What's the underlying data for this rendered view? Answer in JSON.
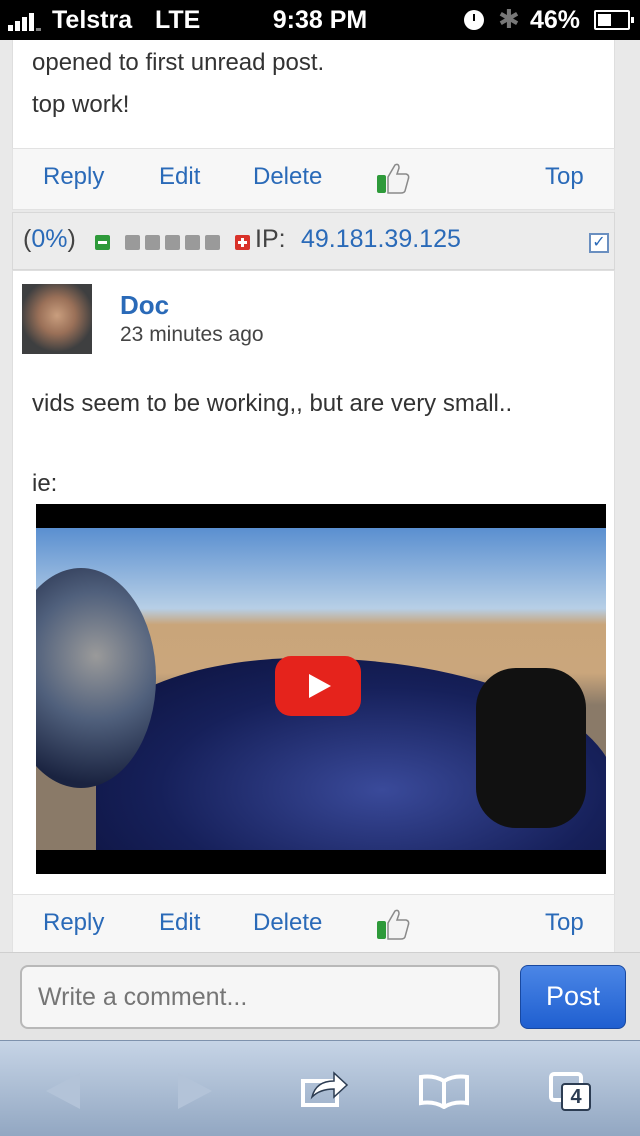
{
  "status_bar": {
    "carrier": "Telstra",
    "network": "LTE",
    "time": "9:38 PM",
    "battery": "46%",
    "battery_level": 0.46,
    "icons": [
      "signal-icon",
      "clock-icon",
      "bluetooth-icon",
      "battery-icon"
    ]
  },
  "previous_post": {
    "lines": [
      "opened to first unread post.",
      "top work!"
    ],
    "actions": {
      "reply": "Reply",
      "edit": "Edit",
      "delete": "Delete",
      "top": "Top"
    }
  },
  "meta": {
    "percent_open": "(",
    "percent": "0%",
    "percent_close": ")",
    "ip_label": "IP:",
    "ip_value": "49.181.39.125",
    "rating_colors": {
      "minus": "#2e9a3a",
      "empty": "#9a9a9a",
      "plus": "#d9322a"
    }
  },
  "post": {
    "author": "Doc",
    "timestamp": "23 minutes ago",
    "line1": "vids seem to be working,, but are very small..",
    "line2": "ie:",
    "actions": {
      "reply": "Reply",
      "edit": "Edit",
      "delete": "Delete",
      "top": "Top"
    }
  },
  "comment": {
    "placeholder": "Write a comment...",
    "post_label": "Post"
  },
  "toolbar": {
    "tab_count": "4",
    "icons": [
      "back-icon",
      "forward-icon",
      "share-icon",
      "bookmarks-icon",
      "tabs-icon"
    ]
  },
  "colors": {
    "link": "#2a6ab8",
    "post_button": "#1f5fd0",
    "youtube_red": "#e5231c"
  }
}
